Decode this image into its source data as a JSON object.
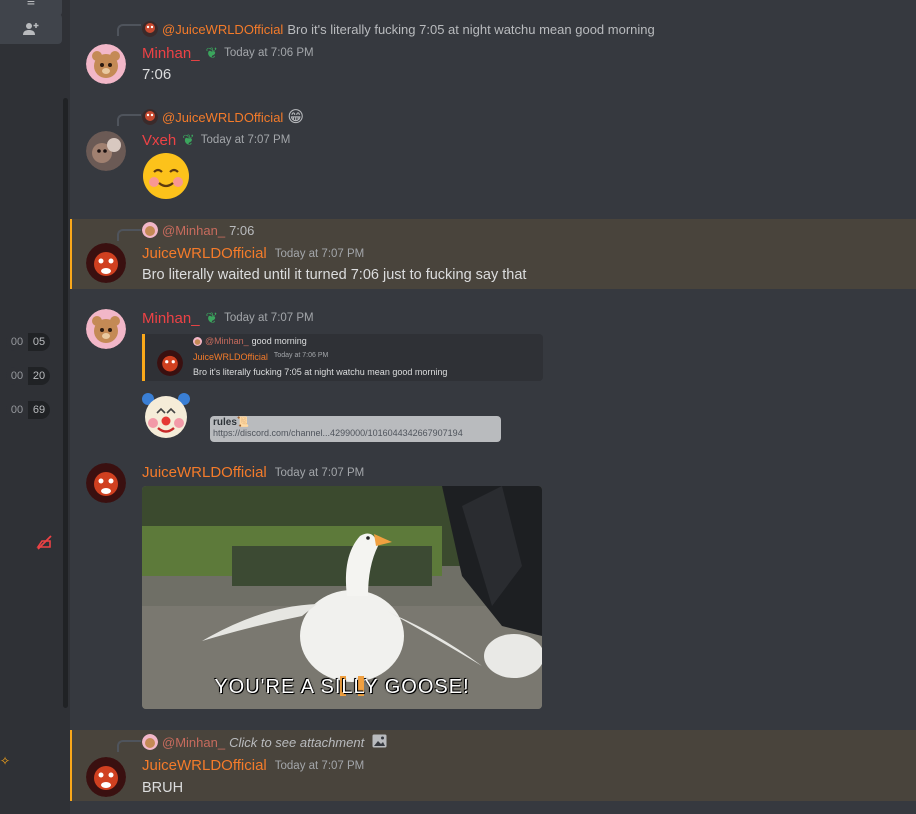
{
  "sidebar": {
    "voice_stats": [
      {
        "left": "00",
        "right": "05"
      },
      {
        "left": "00",
        "right": "20"
      },
      {
        "left": "00",
        "right": "69"
      }
    ],
    "icons": [
      "menu-icon",
      "add-friend-icon",
      "mute-icon"
    ]
  },
  "messages": [
    {
      "reply": {
        "name": "@JuiceWRLDOfficial",
        "text": "Bro it's literally fucking 7:05 at night watchu mean good morning"
      },
      "author": "Minhan_",
      "timestamp": "Today at 7:06 PM",
      "content": "7:06"
    },
    {
      "reply": {
        "name": "@JuiceWRLDOfficial",
        "text": "😁"
      },
      "author": "Vxeh",
      "timestamp": "Today at 7:07 PM",
      "emoji": "☺"
    },
    {
      "reply": {
        "name": "@Minhan_",
        "text": "7:06"
      },
      "author": "JuiceWRLDOfficial",
      "timestamp": "Today at 7:07 PM",
      "content": "Bro literally waited until it turned 7:06 just to fucking say that"
    },
    {
      "author": "Minhan_",
      "timestamp": "Today at 7:07 PM",
      "quoted": {
        "reply_name": "@Minhan_",
        "reply_text": "good morning",
        "author": "JuiceWRLDOfficial",
        "timestamp": "Today at 7:06 PM",
        "content": "Bro it's literally fucking 7:05 at night watchu mean good morning"
      },
      "emoji": "🤡",
      "link": {
        "title": "rules📜",
        "url": "https://discord.com/channel...4299000/1016044342667907194"
      }
    },
    {
      "author": "JuiceWRLDOfficial",
      "timestamp": "Today at 7:07 PM",
      "gif_caption": "YOU'RE A SILLY GOOSE!"
    },
    {
      "reply": {
        "name": "@Minhan_",
        "text": "Click to see attachment"
      },
      "author": "JuiceWRLDOfficial",
      "timestamp": "Today at 7:07 PM",
      "content": "BRUH"
    }
  ],
  "colors": {
    "background": "#36393f",
    "mention_highlight": "#49443c",
    "mention_bar": "#faa81a",
    "minhan": "#ed4245",
    "juice": "#f47b2a"
  }
}
